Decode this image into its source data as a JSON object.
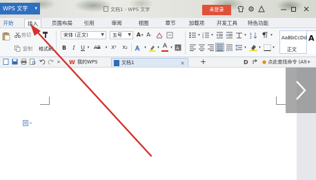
{
  "titlebar": {
    "app_name": "WPS 文字",
    "app_caret": "▾",
    "doc_title": "文档1 - WPS 文字",
    "login_label": "未登录",
    "icons": [
      "shirt-icon",
      "gear-icon",
      "minimize-icon",
      "restore-icon",
      "close-icon"
    ]
  },
  "menu": {
    "tabs": [
      {
        "label": "开始",
        "active": true
      },
      {
        "label": "插入",
        "active": false
      },
      {
        "label": "页面布局",
        "active": false
      },
      {
        "label": "引用",
        "active": false
      },
      {
        "label": "审阅",
        "active": false
      },
      {
        "label": "视图",
        "active": false
      },
      {
        "label": "章节",
        "active": false
      },
      {
        "label": "加载项",
        "active": false
      },
      {
        "label": "开发工具",
        "active": false
      },
      {
        "label": "特色功能",
        "active": false
      }
    ]
  },
  "ribbon": {
    "cut_label": "剪切",
    "copy_label": "复制",
    "format_painter_label": "格式刷",
    "font_name": "宋体 (正文)",
    "font_size": "五号",
    "bold": "B",
    "italic": "I",
    "underline": "U",
    "strike": "AB",
    "superscript": "X²",
    "subscript": "X₂",
    "font_color_letter": "A",
    "style_preview": "AaBbCcDd",
    "style_name": "正文",
    "style_next": "A"
  },
  "docbar": {
    "mywps_label": "我的WPS",
    "doc_tab_label": "文档1",
    "add_tab": "+",
    "command_search": "点此查找命令 (Alt+"
  },
  "colors": {
    "accent": "#2f6fc0",
    "login_red": "#e0513a",
    "arrow_red": "#d4322c"
  }
}
